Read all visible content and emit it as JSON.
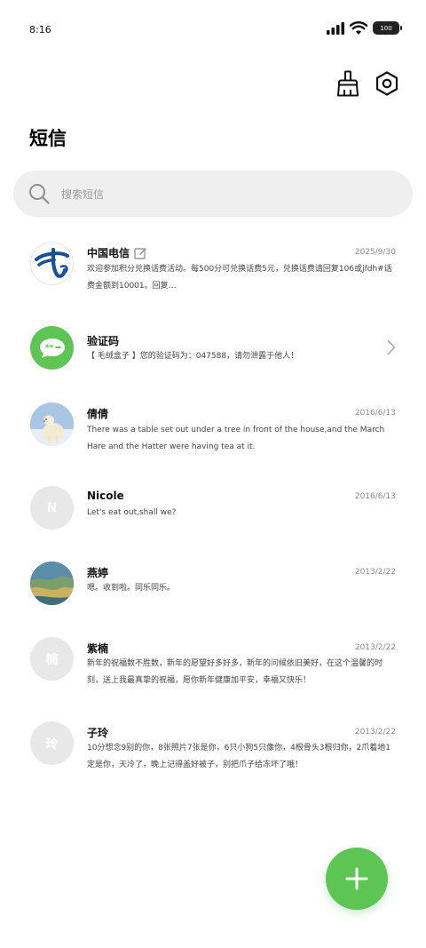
{
  "status_bar": {
    "time": "8:16",
    "battery": "100"
  },
  "header": {
    "title": "短信",
    "clean_icon": "broom-icon",
    "settings_icon": "hex-gear-icon"
  },
  "search": {
    "placeholder": "搜索短信"
  },
  "messages": [
    {
      "name": "中国电信",
      "date": "2025/9/30",
      "text": "欢迎参加积分兑换话费活动。每500分可兑换话费5元，兑换话费请回复106或jfdh#话费金额到10001。回复…",
      "avatar": "china-telecom-logo"
    },
    {
      "name": "验证码",
      "date": "",
      "text": "【 毛绒盒子 】您的验证码为：047588，请勿泄露于他人！",
      "avatar": "sms-bubble-icon"
    },
    {
      "name": "倩倩",
      "date": "2016/6/13",
      "text": "There was a table set out under a tree in front of the house,and the March Hare and the Hatter were having tea at it.",
      "avatar": "polar-bear-photo"
    },
    {
      "name": "Nicole",
      "date": "2016/6/13",
      "text": "Let's eat out,shall we?",
      "avatar_letter": "N"
    },
    {
      "name": "燕婷",
      "date": "2013/2/22",
      "text": "嗯。收到啦。同乐同乐。",
      "avatar": "landscape-photo"
    },
    {
      "name": "紫楠",
      "date": "2013/2/22",
      "text": "新年的祝福数不胜数，新年的愿望好多好多，新年的问候依旧美好，在这个温馨的时刻，送上我最真挚的祝福，愿你新年健康加平安，幸福又快乐！",
      "avatar_letter": "楠"
    },
    {
      "name": "子玲",
      "date": "2013/2/22",
      "text": "10分想念9别的你，8张照片7张是你，6只小狗5只像你，4根骨头3根归你，2爪着地1定是你，天冷了，晚上记得盖好被子，别把爪子给冻坏了哦！",
      "avatar_letter": "玲"
    }
  ],
  "colors": {
    "accent_green": "#5cc553",
    "telecom_blue": "#1a4f9c"
  },
  "fab": {
    "icon": "plus-icon"
  }
}
